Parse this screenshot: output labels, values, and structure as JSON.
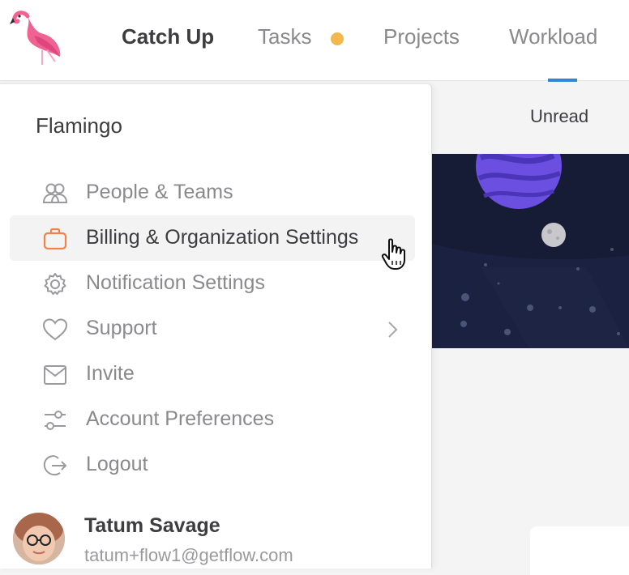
{
  "colors": {
    "accent_blue": "#2f86d6",
    "tasks_dot": "#f2b84b",
    "billing_icon": "#f0824a",
    "hero_bg": "#1b2140",
    "planet": "#6a4fe0"
  },
  "nav": {
    "items": [
      {
        "label": "Catch Up",
        "active": true
      },
      {
        "label": "Tasks",
        "active": false
      },
      {
        "label": "Projects",
        "active": false
      },
      {
        "label": "Workload",
        "active": false
      }
    ]
  },
  "subbar": {
    "filter_label": "Unread"
  },
  "menu": {
    "org_name": "Flamingo",
    "items": [
      {
        "label": "People & Teams",
        "icon": "people-icon"
      },
      {
        "label": "Billing & Organization Settings",
        "icon": "briefcase-icon"
      },
      {
        "label": "Notification Settings",
        "icon": "gear-icon"
      },
      {
        "label": "Support",
        "icon": "heart-icon"
      },
      {
        "label": "Invite",
        "icon": "envelope-icon"
      },
      {
        "label": "Account Preferences",
        "icon": "sliders-icon"
      },
      {
        "label": "Logout",
        "icon": "logout-icon"
      }
    ]
  },
  "user": {
    "name": "Tatum Savage",
    "email": "tatum+flow1@getflow.com"
  }
}
